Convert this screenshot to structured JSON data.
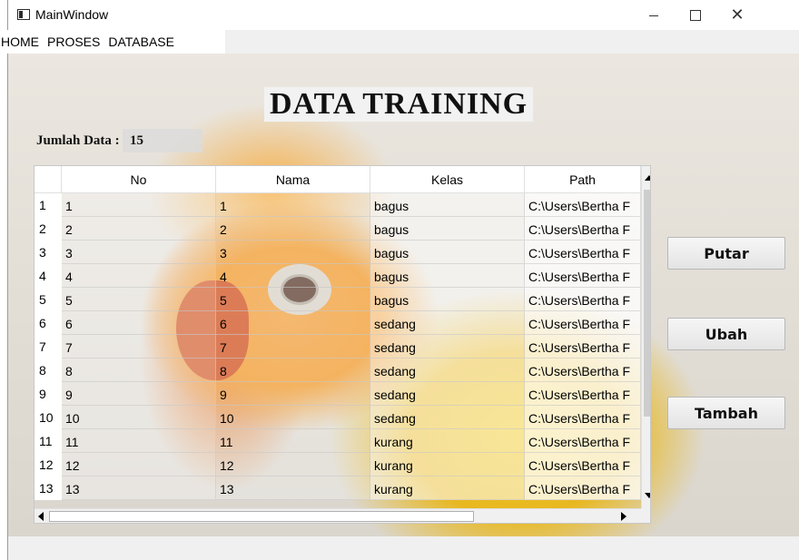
{
  "window": {
    "title": "MainWindow",
    "controls": {
      "minimize": "—",
      "maximize": "☐",
      "close": "✕"
    }
  },
  "menu": {
    "items": [
      {
        "label": "HOME"
      },
      {
        "label": "PROSES"
      },
      {
        "label": "DATABASE"
      }
    ]
  },
  "page": {
    "heading": "DATA TRAINING",
    "count_label": "Jumlah Data :",
    "count_value": "15"
  },
  "table": {
    "columns": [
      "No",
      "Nama",
      "Kelas",
      "Path"
    ],
    "rows": [
      {
        "header": "1",
        "cells": [
          "1",
          "1",
          "bagus",
          "C:\\Users\\Bertha F"
        ]
      },
      {
        "header": "2",
        "cells": [
          "2",
          "2",
          "bagus",
          "C:\\Users\\Bertha F"
        ]
      },
      {
        "header": "3",
        "cells": [
          "3",
          "3",
          "bagus",
          "C:\\Users\\Bertha F"
        ]
      },
      {
        "header": "4",
        "cells": [
          "4",
          "4",
          "bagus",
          "C:\\Users\\Bertha F"
        ]
      },
      {
        "header": "5",
        "cells": [
          "5",
          "5",
          "bagus",
          "C:\\Users\\Bertha F"
        ]
      },
      {
        "header": "6",
        "cells": [
          "6",
          "6",
          "sedang",
          "C:\\Users\\Bertha F"
        ]
      },
      {
        "header": "7",
        "cells": [
          "7",
          "7",
          "sedang",
          "C:\\Users\\Bertha F"
        ]
      },
      {
        "header": "8",
        "cells": [
          "8",
          "8",
          "sedang",
          "C:\\Users\\Bertha F"
        ]
      },
      {
        "header": "9",
        "cells": [
          "9",
          "9",
          "sedang",
          "C:\\Users\\Bertha F"
        ]
      },
      {
        "header": "10",
        "cells": [
          "10",
          "10",
          "sedang",
          "C:\\Users\\Bertha F"
        ]
      },
      {
        "header": "11",
        "cells": [
          "11",
          "11",
          "kurang",
          "C:\\Users\\Bertha F"
        ]
      },
      {
        "header": "12",
        "cells": [
          "12",
          "12",
          "kurang",
          "C:\\Users\\Bertha F"
        ]
      },
      {
        "header": "13",
        "cells": [
          "13",
          "13",
          "kurang",
          "C:\\Users\\Bertha F"
        ]
      }
    ]
  },
  "actions": {
    "putar": "Putar",
    "ubah": "Ubah",
    "tambah": "Tambah"
  }
}
